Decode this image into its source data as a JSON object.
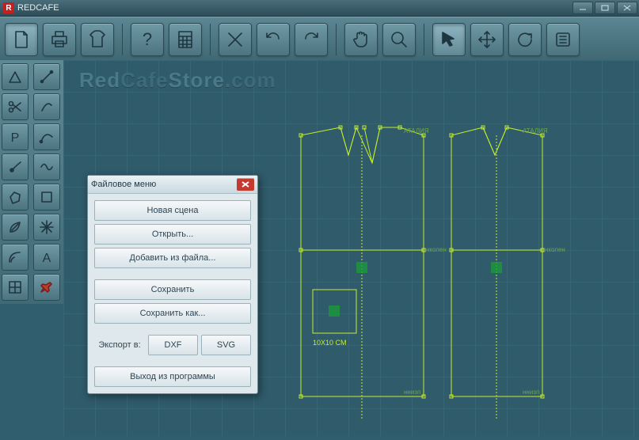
{
  "app": {
    "title": "REDCAFE",
    "badge": "R"
  },
  "watermark": {
    "a": "Red",
    "b": "Cafe",
    "c": "Store",
    "d": ".com"
  },
  "toolbar": {
    "new": "New",
    "print": "Print",
    "garment": "Garment",
    "help": "Help",
    "calc": "Calc",
    "delete": "Delete",
    "undo": "Undo",
    "redo": "Redo",
    "pan": "Pan",
    "zoom": "Zoom",
    "select": "Select",
    "move": "Move",
    "rotate": "Rotate",
    "prefs": "Prefs"
  },
  "tools_left": [
    [
      "triangle",
      "slash"
    ],
    [
      "scissors",
      "curve"
    ],
    [
      "p-tool",
      "bezier"
    ],
    [
      "dot",
      "wave"
    ],
    [
      "poly",
      "rect"
    ],
    [
      "leaf",
      "star"
    ],
    [
      "arc",
      "a-tool"
    ],
    [
      "grid",
      "pin"
    ]
  ],
  "dialog": {
    "title": "Файловое меню",
    "items": {
      "new_scene": "Новая сцена",
      "open": "Открыть...",
      "add_from_file": "Добавить из файла...",
      "save": "Сохранить",
      "save_as": "Сохранить как...",
      "export_label": "Экспорт в:",
      "dxf": "DXF",
      "svg": "SVG",
      "exit": "Выход из программы"
    }
  },
  "canvas": {
    "scale_label": "10X10 CM",
    "markers": [
      "АТАЛИЯ",
      "АТАЛИЯ",
      "нколен",
      "нколен",
      "ннизп",
      "ннизп"
    ]
  }
}
